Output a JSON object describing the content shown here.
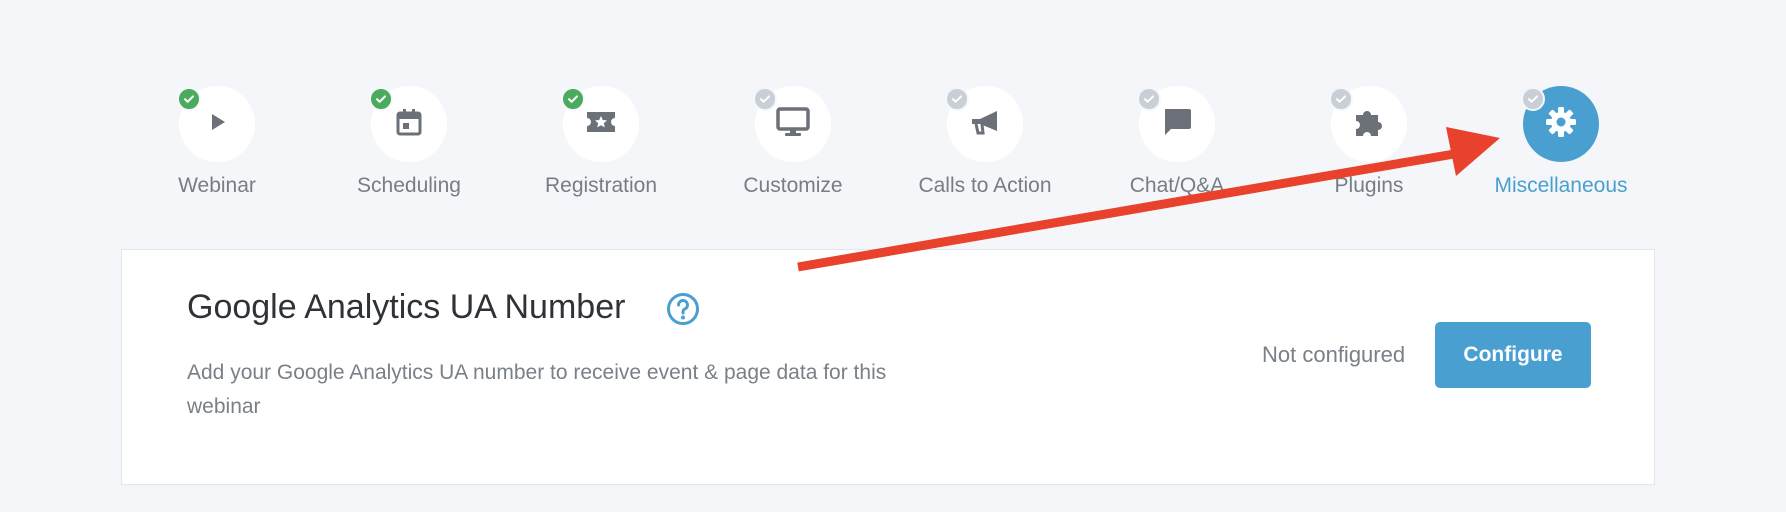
{
  "steps": [
    {
      "label": "Webinar",
      "icon": "play-icon",
      "status": "complete"
    },
    {
      "label": "Scheduling",
      "icon": "calendar-icon",
      "status": "complete"
    },
    {
      "label": "Registration",
      "icon": "ticket-icon",
      "status": "complete"
    },
    {
      "label": "Customize",
      "icon": "monitor-icon",
      "status": "incomplete"
    },
    {
      "label": "Calls to Action",
      "icon": "megaphone-icon",
      "status": "incomplete"
    },
    {
      "label": "Chat/Q&A",
      "icon": "chat-bubble-icon",
      "status": "incomplete"
    },
    {
      "label": "Plugins",
      "icon": "puzzle-icon",
      "status": "incomplete"
    },
    {
      "label": "Miscellaneous",
      "icon": "gear-icon",
      "status": "active"
    }
  ],
  "setting": {
    "title": "Google Analytics UA Number",
    "description": "Add your Google Analytics UA number to receive event & page data for this webinar",
    "status": "Not configured",
    "button_label": "Configure",
    "help_icon": "question-circle-icon"
  },
  "colors": {
    "accent": "#4a9fd1",
    "check_complete": "#4caa5f",
    "check_incomplete": "#c8cfd6",
    "annotation_arrow": "#e8412c",
    "background": "#f4f6f9"
  }
}
